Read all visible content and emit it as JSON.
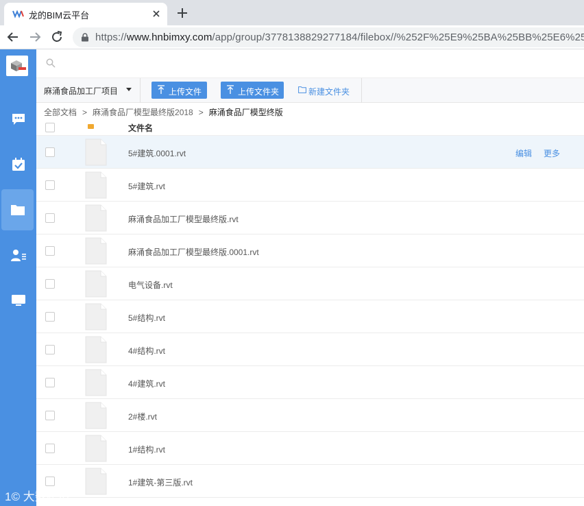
{
  "browser": {
    "tab_title": "龙的BIM云平台",
    "url_scheme": "https://",
    "url_host": "www.hnbimxy.com",
    "url_path": "/app/group/3778138829277184/filebox//%252F%25E9%25BA%25BB%25E6%25"
  },
  "toolbar": {
    "project_name": "麻涌食品加工厂项目",
    "upload_file_label": "上传文件",
    "upload_folder_label": "上传文件夹",
    "new_folder_label": "新建文件夹"
  },
  "breadcrumb": [
    "全部文档",
    "麻涌食品厂模型最终版2018",
    "麻涌食品厂模型终版"
  ],
  "list": {
    "name_header": "文件名",
    "row_actions": {
      "edit": "编辑",
      "more": "更多"
    },
    "files": [
      "5#建筑.0001.rvt",
      "5#建筑.rvt",
      "麻涌食品加工厂模型最终版.rvt",
      "麻涌食品加工厂模型最终版.0001.rvt",
      "电气设备.rvt",
      "5#结构.rvt",
      "4#结构.rvt",
      "4#建筑.rvt",
      "2#楼.rvt",
      "1#结构.rvt",
      "1#建筑-第三版.rvt"
    ]
  },
  "sidebar_icons": [
    "chat-icon",
    "calendar-check-icon",
    "folder-icon",
    "user-list-icon",
    "monitor-icon"
  ],
  "colors": {
    "accent": "#4a90e2",
    "folder_dot": "#f0a830",
    "hover_row": "#eef5fb"
  },
  "watermark": "大数跨境"
}
